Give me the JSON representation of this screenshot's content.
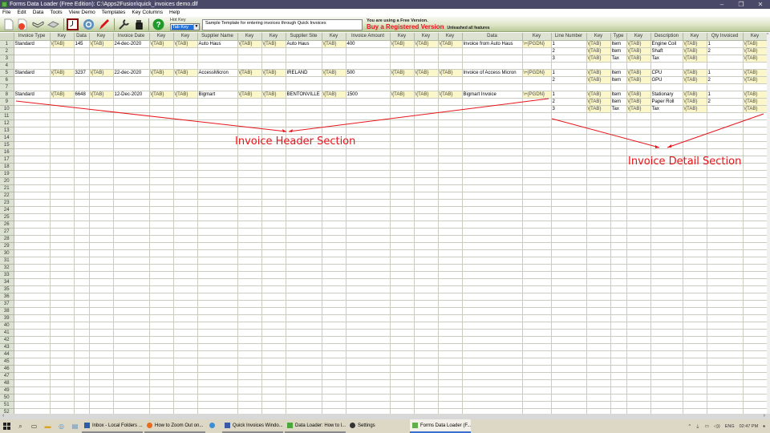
{
  "window": {
    "title": "Forms Data Loader (Free Edition): C:\\Apps2Fusion\\quick_invoices demo.dlf",
    "controls": [
      "–",
      "❐",
      "✕"
    ]
  },
  "menu": [
    "File",
    "Edit",
    "Data",
    "Tools",
    "View Demo",
    "Templates",
    "Key Columns",
    "Help"
  ],
  "toolbar": {
    "icons": [
      "new-file-icon",
      "pdf-icon",
      "open-book-icon",
      "eraser-icon",
      "clock-icon",
      "refresh-icon",
      "pencil-icon",
      "wrench-icon",
      "hand-pointer-icon",
      "help-icon"
    ],
    "hotkey_label": "Hot Key",
    "hotkey_value": "Tab Key",
    "template_description": "Sample Template for entering invoices through Quick Invoices",
    "promo_line1": "You are using a Free Version.",
    "promo_line2": "Buy a Registered Version",
    "promo_line3": "Unleashed all features"
  },
  "sheet": {
    "columns": [
      "Invoice Type",
      "Key",
      "Data",
      "Key",
      "Invoice Date",
      "Key",
      "Key",
      "Supplier Name",
      "Key",
      "Key",
      "Supplier Site",
      "Key",
      "Invoice Amount",
      "Key",
      "Key",
      "Key",
      "Data",
      "Key",
      "Line Number",
      "Key",
      "Type",
      "Key",
      "Description",
      "Key",
      "Qty Invoiced",
      "Key"
    ],
    "key_columns": [
      1,
      3,
      5,
      6,
      8,
      9,
      11,
      13,
      14,
      15,
      17,
      19,
      21,
      23,
      25
    ],
    "row_count": 52,
    "rows": {
      "1": [
        "Standard",
        "\\{TAB}",
        "145",
        "\\{TAB}",
        "24-dec-2020",
        "\\{TAB}",
        "\\{TAB}",
        "Auto Haus",
        "\\{TAB}",
        "\\{TAB}",
        "Auto Haus",
        "\\{TAB}",
        "400",
        "\\{TAB}",
        "\\{TAB}",
        "\\{TAB}",
        "Invoice from Auto Haus",
        "\\+{PGDN}",
        "1",
        "\\{TAB}",
        "Item",
        "\\{TAB}",
        "Engine Coil",
        "\\{TAB}",
        "1",
        "\\{TAB}"
      ],
      "2": [
        "",
        "",
        "",
        "",
        "",
        "",
        "",
        "",
        "",
        "",
        "",
        "",
        "",
        "",
        "",
        "",
        "",
        "",
        "2",
        "\\{TAB}",
        "Item",
        "\\{TAB}",
        "Shaft",
        "\\{TAB}",
        "2",
        "\\{TAB}"
      ],
      "3": [
        "",
        "",
        "",
        "",
        "",
        "",
        "",
        "",
        "",
        "",
        "",
        "",
        "",
        "",
        "",
        "",
        "",
        "",
        "3",
        "\\{TAB}",
        "Tax",
        "\\{TAB}",
        "Tax",
        "\\{TAB}",
        "",
        "\\{TAB}"
      ],
      "5": [
        "Standard",
        "\\{TAB}",
        "3237",
        "\\{TAB}",
        "22-dec-2020",
        "\\{TAB}",
        "\\{TAB}",
        "AccessMicron",
        "\\{TAB}",
        "\\{TAB}",
        "IRELAND",
        "\\{TAB}",
        "500",
        "\\{TAB}",
        "\\{TAB}",
        "\\{TAB}",
        "Invoice of Access Micron",
        "\\+{PGDN}",
        "1",
        "\\{TAB}",
        "Item",
        "\\{TAB}",
        "CPU",
        "\\{TAB}",
        "1",
        "\\{TAB}"
      ],
      "6": [
        "",
        "",
        "",
        "",
        "",
        "",
        "",
        "",
        "",
        "",
        "",
        "",
        "",
        "",
        "",
        "",
        "",
        "",
        "2",
        "\\{TAB}",
        "Item",
        "\\{TAB}",
        "GPU",
        "\\{TAB}",
        "2",
        "\\{TAB}"
      ],
      "8": [
        "Standard",
        "\\{TAB}",
        "6648",
        "\\{TAB}",
        "12-Dec-2020",
        "\\{TAB}",
        "\\{TAB}",
        "Bigmart",
        "\\{TAB}",
        "\\{TAB}",
        "BENTONVILLE",
        "\\{TAB}",
        "1500",
        "\\{TAB}",
        "\\{TAB}",
        "\\{TAB}",
        "Bigmart Invoice",
        "\\+{PGDN}",
        "1",
        "\\{TAB}",
        "Item",
        "\\{TAB}",
        "Stationary",
        "\\{TAB}",
        "1",
        "\\{TAB}"
      ],
      "9": [
        "",
        "",
        "",
        "",
        "",
        "",
        "",
        "",
        "",
        "",
        "",
        "",
        "",
        "",
        "",
        "",
        "",
        "",
        "2",
        "\\{TAB}",
        "Item",
        "\\{TAB}",
        "Paper Roll",
        "\\{TAB}",
        "2",
        "\\{TAB}"
      ],
      "10": [
        "",
        "",
        "",
        "",
        "",
        "",
        "",
        "",
        "",
        "",
        "",
        "",
        "",
        "",
        "",
        "",
        "",
        "",
        "3",
        "\\{TAB}",
        "Tax",
        "\\{TAB}",
        "Tax",
        "\\{TAB}",
        "",
        "\\{TAB}"
      ]
    }
  },
  "annotations": {
    "header_section": "Invoice Header Section",
    "detail_section": "Invoice Detail Section",
    "color": "#e8141a"
  },
  "taskbar": {
    "items": [
      {
        "label": "Inbox - Local Folders ...",
        "icon": "thunderbird-icon",
        "active": false
      },
      {
        "label": "How to Zoom Out on...",
        "icon": "firefox-icon",
        "active": false
      },
      {
        "label": "",
        "icon": "ie-icon",
        "active": false
      },
      {
        "label": "Quick Invoices Windo...",
        "icon": "document-icon",
        "active": false
      },
      {
        "label": "Data Loader: How to l...",
        "icon": "data-loader-icon",
        "active": false
      },
      {
        "label": "Settings",
        "icon": "gear-icon",
        "active": false
      },
      {
        "label": "Forms Data Loader (F...",
        "icon": "forms-data-loader-icon",
        "active": true
      }
    ],
    "language": "ENG",
    "time": "02:47 PM"
  }
}
